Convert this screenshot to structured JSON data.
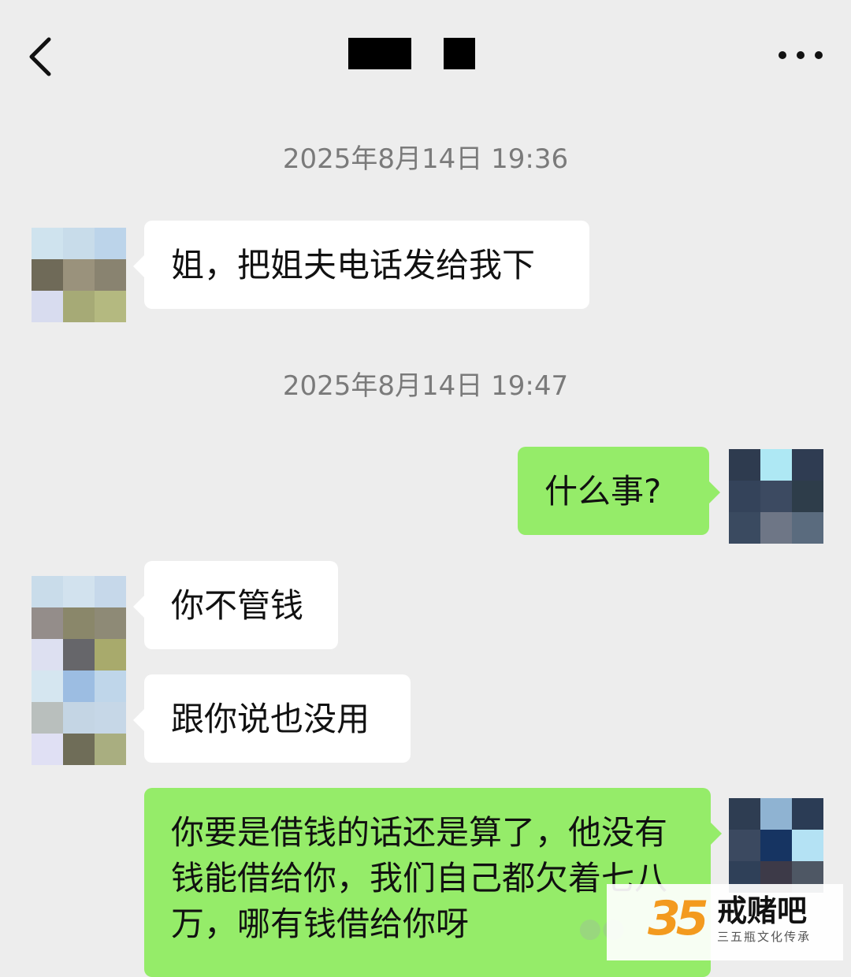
{
  "header": {
    "back_icon": "chevron-left-icon",
    "more_icon": "more-dots-icon"
  },
  "messages": [
    {
      "type": "timestamp",
      "text": "2025年8月14日 19:36"
    },
    {
      "type": "in",
      "text": "姐，把姐夫电话发给我下"
    },
    {
      "type": "timestamp",
      "text": "2025年8月14日 19:47"
    },
    {
      "type": "out",
      "text": "什么事?"
    },
    {
      "type": "in",
      "text": "你不管钱"
    },
    {
      "type": "in",
      "text": "跟你说也没用"
    },
    {
      "type": "out",
      "text": "你要是借钱的话还是算了，他没有钱能借给你，我们自己都欠着七八万，哪有钱借给你呀"
    }
  ],
  "watermark": {
    "logo": "35",
    "title": "戒赌吧",
    "subtitle": "三五瓶文化传承"
  },
  "colors": {
    "background": "#ededed",
    "incoming_bubble": "#ffffff",
    "outgoing_bubble": "#95ec69",
    "timestamp_text": "#7a7a7a",
    "watermark_logo": "#f39a1e"
  }
}
